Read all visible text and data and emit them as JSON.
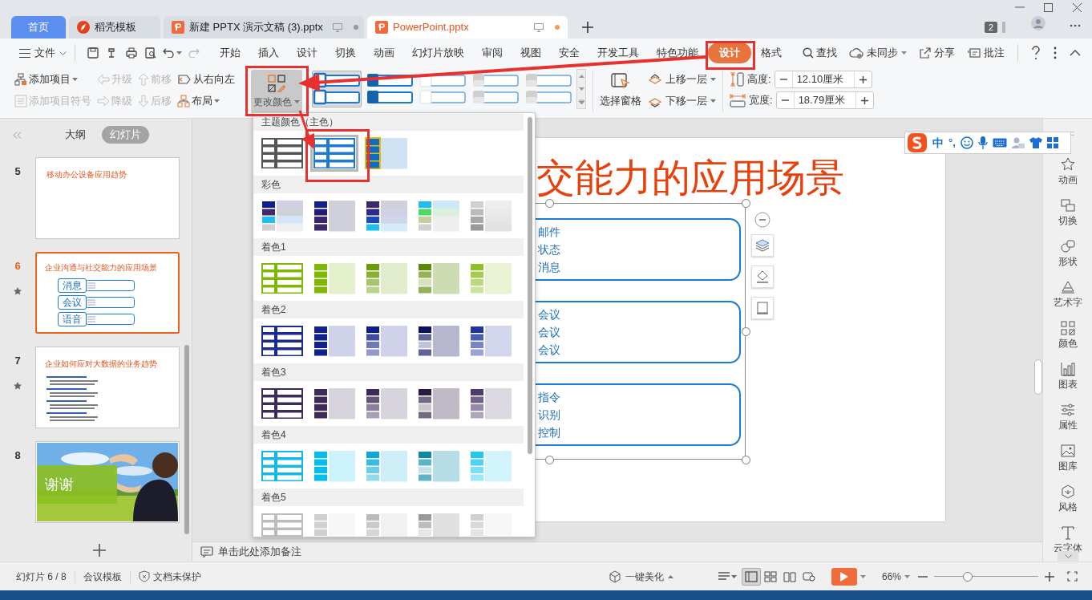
{
  "doc_tabs": [
    {
      "label": "首页",
      "kind": "home",
      "selected": false
    },
    {
      "label": "稻壳模板",
      "kind": "docer",
      "selected": false
    },
    {
      "label": "新建 PPTX 演示文稿 (3).pptx",
      "kind": "file",
      "selected": false
    },
    {
      "label": "PowerPoint.pptx",
      "kind": "file",
      "selected": true
    }
  ],
  "tab_badge": "2",
  "file_menu": "文件",
  "menu_tabs": [
    {
      "label": "开始",
      "selected": false
    },
    {
      "label": "插入",
      "selected": false
    },
    {
      "label": "设计",
      "selected": false
    },
    {
      "label": "切换",
      "selected": false
    },
    {
      "label": "动画",
      "selected": false
    },
    {
      "label": "幻灯片放映",
      "selected": false
    },
    {
      "label": "审阅",
      "selected": false
    },
    {
      "label": "视图",
      "selected": false
    },
    {
      "label": "安全",
      "selected": false
    },
    {
      "label": "开发工具",
      "selected": false
    },
    {
      "label": "特色功能",
      "selected": false
    },
    {
      "label": "设计",
      "selected": true
    },
    {
      "label": "格式",
      "selected": false
    }
  ],
  "find": "查找",
  "menu_right": [
    {
      "label": "未同步",
      "kind": "sync"
    },
    {
      "label": "分享",
      "kind": "share"
    },
    {
      "label": "批注",
      "kind": "comment"
    }
  ],
  "ribbon_commands": [
    [
      {
        "label": "添加项目",
        "kind": "add-item",
        "dropdown": true,
        "disabled": false
      },
      {
        "label": "添加项目符号",
        "kind": "bullet",
        "dropdown": false,
        "disabled": true
      }
    ],
    [
      {
        "label": "升级",
        "kind": "promote",
        "dropdown": false,
        "disabled": true
      },
      {
        "label": "降级",
        "kind": "demote",
        "dropdown": false,
        "disabled": true
      }
    ],
    [
      {
        "label": "前移",
        "kind": "forward",
        "dropdown": false,
        "disabled": true
      },
      {
        "label": "后移",
        "kind": "backward",
        "dropdown": false,
        "disabled": true
      }
    ],
    [
      {
        "label": "从右向左",
        "kind": "rtl",
        "dropdown": false,
        "disabled": false
      },
      {
        "label": "布局",
        "kind": "layout",
        "dropdown": true,
        "disabled": false
      }
    ]
  ],
  "change_color": {
    "label": "更改颜色",
    "pressed": true
  },
  "style_gallery": [
    {
      "kind": "outline",
      "selected": true
    },
    {
      "kind": "dark",
      "selected": false
    },
    {
      "kind": "plain",
      "selected": false
    },
    {
      "kind": "shaded",
      "selected": false
    },
    {
      "kind": "shaded",
      "selected": false
    }
  ],
  "select_pane": "选择窗格",
  "layer_buttons": [
    {
      "label": "上移一层",
      "kind": "up"
    },
    {
      "label": "下移一层",
      "kind": "down"
    }
  ],
  "size_fields": [
    {
      "label": "高度:",
      "value": "12.10厘米",
      "kind": "height"
    },
    {
      "label": "宽度:",
      "value": "18.79厘米",
      "kind": "width"
    }
  ],
  "panel_tabs": [
    {
      "label": "大纲",
      "selected": false
    },
    {
      "label": "幻灯片",
      "selected": true
    }
  ],
  "slides": [
    {
      "number": "5",
      "kind": "title",
      "title": "移动办公设备应用趋势",
      "selected": false,
      "animated": false
    },
    {
      "number": "6",
      "kind": "boxes",
      "title": "企业沟通与社交能力的应用场景",
      "items": [
        "消息",
        "会议",
        "语音"
      ],
      "selected": true,
      "animated": true
    },
    {
      "number": "7",
      "kind": "bullets",
      "title": "企业如何应对大数据的业务趋势",
      "selected": false,
      "animated": true
    },
    {
      "number": "8",
      "title": "谢谢",
      "selected": false,
      "animated": false
    }
  ],
  "slide": {
    "title": "交能力的应用场景",
    "boxes": [
      [
        "邮件",
        "状态",
        "消息"
      ],
      [
        "会议",
        "会议",
        "会议"
      ],
      [
        "指令",
        "识别",
        "控制"
      ]
    ]
  },
  "color_menu": [
    {
      "title": "主题颜色（主色）",
      "swatches": [
        {
          "kind": "outline",
          "color": "#555555",
          "selected": false
        },
        {
          "kind": "outline",
          "color": "#1a7ad4",
          "selected": true
        },
        {
          "kind": "framed",
          "color": "#0a6fc4",
          "selected": false
        }
      ]
    },
    {
      "title": "彩色",
      "swatches": [
        {
          "kind": "multi",
          "color": "#0f1f8f",
          "selected": false
        },
        {
          "kind": "multi",
          "color": "#11228f",
          "selected": false
        },
        {
          "kind": "multi",
          "color": "#3d2a6b",
          "selected": false
        },
        {
          "kind": "multi",
          "color": "#1fbdf0",
          "selected": false
        },
        {
          "kind": "multi",
          "color": "#d0d0d0",
          "selected": false
        }
      ]
    },
    {
      "title": "着色1",
      "swatches": [
        {
          "kind": "outline",
          "color": "#7fb800",
          "selected": false
        },
        {
          "kind": "solid",
          "color": "#7fb800",
          "selected": false
        },
        {
          "kind": "ramp",
          "color": "#6a9e00",
          "selected": false
        },
        {
          "kind": "accent",
          "color": "#5a8a00",
          "selected": false
        },
        {
          "kind": "ramp",
          "color": "#8fc020",
          "selected": false
        }
      ]
    },
    {
      "title": "着色2",
      "swatches": [
        {
          "kind": "outline",
          "color": "#1a2a90",
          "selected": false
        },
        {
          "kind": "solid",
          "color": "#11228f",
          "selected": false
        },
        {
          "kind": "ramp",
          "color": "#0f1f8a",
          "selected": false
        },
        {
          "kind": "accent",
          "color": "#0a1060",
          "selected": false
        },
        {
          "kind": "ramp",
          "color": "#1f34a0",
          "selected": false
        }
      ]
    },
    {
      "title": "着色3",
      "swatches": [
        {
          "kind": "outline",
          "color": "#3e2a5a",
          "selected": false
        },
        {
          "kind": "solid",
          "color": "#3e2a5a",
          "selected": false
        },
        {
          "kind": "ramp",
          "color": "#3e2a5a",
          "selected": false
        },
        {
          "kind": "accent",
          "color": "#2a1a40",
          "selected": false
        },
        {
          "kind": "ramp",
          "color": "#4e3a6e",
          "selected": false
        }
      ]
    },
    {
      "title": "着色4",
      "swatches": [
        {
          "kind": "outline",
          "color": "#12b8e8",
          "selected": false
        },
        {
          "kind": "solid",
          "color": "#00bff0",
          "selected": false
        },
        {
          "kind": "ramp",
          "color": "#0aaad8",
          "selected": false
        },
        {
          "kind": "accent",
          "color": "#0a8aa8",
          "selected": false
        },
        {
          "kind": "ramp",
          "color": "#20c8f0",
          "selected": false
        }
      ]
    },
    {
      "title": "着色5",
      "swatches": [
        {
          "kind": "outline",
          "color": "#bbbbbb",
          "selected": false
        },
        {
          "kind": "solid",
          "color": "#d0d0d0",
          "selected": false
        },
        {
          "kind": "ramp",
          "color": "#bbbbbb",
          "selected": false
        },
        {
          "kind": "accent",
          "color": "#999999",
          "selected": false
        },
        {
          "kind": "ramp",
          "color": "#d0d0d0",
          "selected": false
        }
      ]
    }
  ],
  "ime_bar": {
    "mode": "中",
    "punct": "°,"
  },
  "side_tools": [
    {
      "label": "动画",
      "kind": "animation"
    },
    {
      "label": "切换",
      "kind": "transition"
    },
    {
      "label": "形状",
      "kind": "shape"
    },
    {
      "label": "艺术字",
      "kind": "wordart"
    },
    {
      "label": "颜色",
      "kind": "color"
    },
    {
      "label": "图表",
      "kind": "chart"
    },
    {
      "label": "属性",
      "kind": "property"
    },
    {
      "label": "图库",
      "kind": "gallery"
    },
    {
      "label": "风格",
      "kind": "style"
    },
    {
      "label": "云字体",
      "kind": "font"
    }
  ],
  "notes_placeholder": "单击此处添加备注",
  "status": {
    "slide_counter": "幻灯片 6 / 8",
    "template": "会议模板",
    "protection": "文档未保护",
    "beautify": "一键美化",
    "views": [
      {
        "kind": "normal",
        "selected": true
      },
      {
        "kind": "sorter",
        "selected": false
      },
      {
        "kind": "reading",
        "selected": false
      },
      {
        "kind": "presenter",
        "selected": false
      }
    ],
    "zoom": "66%",
    "zoom_slider": {
      "level": 0.32
    }
  }
}
